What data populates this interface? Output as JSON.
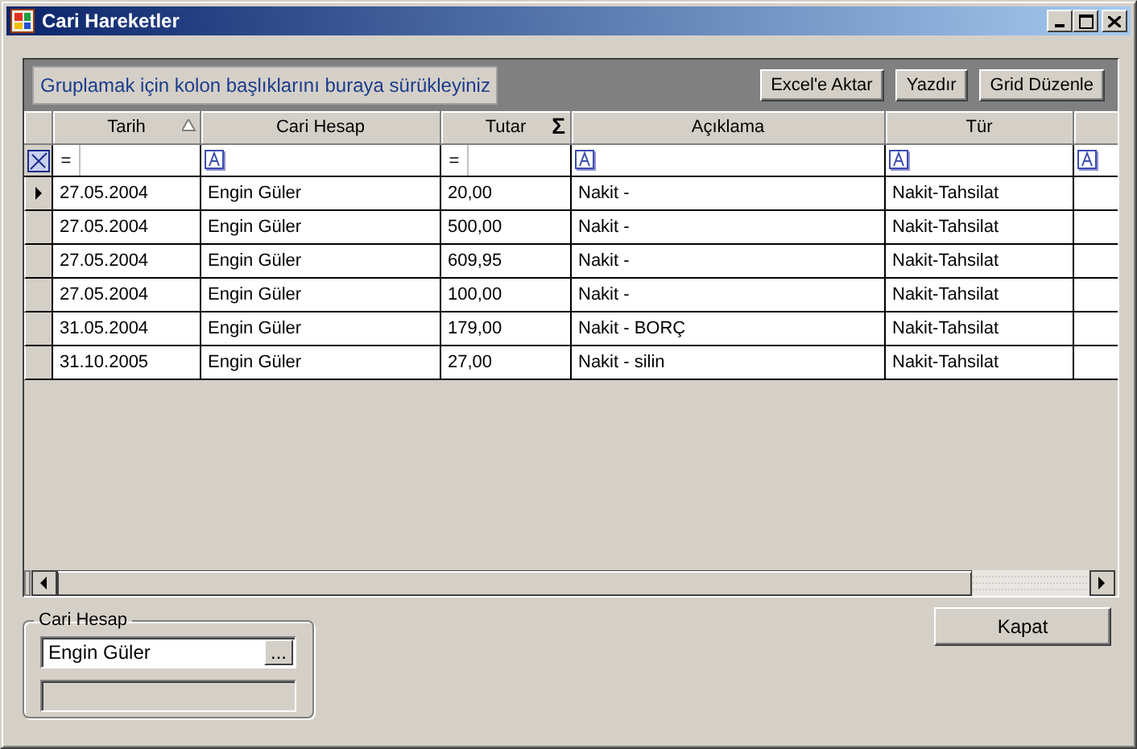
{
  "window": {
    "title": "Cari Hareketler"
  },
  "grid": {
    "group_hint": "Gruplamak için kolon başlıklarını buraya sürükleyiniz",
    "buttons": [
      "Excel'e Aktar",
      "Yazdır",
      "Grid Düzenle"
    ],
    "columns": [
      {
        "label": "Tarih",
        "sorted": true,
        "filter": {
          "kind": "operator",
          "text": "="
        }
      },
      {
        "label": "Cari Hesap",
        "sorted": false,
        "filter": {
          "kind": "text"
        }
      },
      {
        "label": "Tutar",
        "sorted": false,
        "summary": "Σ",
        "filter": {
          "kind": "operator",
          "text": "="
        }
      },
      {
        "label": "Açıklama",
        "sorted": false,
        "filter": {
          "kind": "text"
        }
      },
      {
        "label": "Tür",
        "sorted": false,
        "filter": {
          "kind": "text"
        }
      },
      {
        "sorted": false,
        "filter": {
          "kind": "text"
        }
      }
    ],
    "rows": [
      {
        "selected": true,
        "cells": [
          "27.05.2004",
          "Engin Güler",
          "20,00",
          "Nakit -",
          "Nakit-Tahsilat"
        ]
      },
      {
        "selected": false,
        "cells": [
          "27.05.2004",
          "Engin Güler",
          "500,00",
          "Nakit -",
          "Nakit-Tahsilat"
        ]
      },
      {
        "selected": false,
        "cells": [
          "27.05.2004",
          "Engin Güler",
          "609,95",
          "Nakit -",
          "Nakit-Tahsilat"
        ]
      },
      {
        "selected": false,
        "cells": [
          "27.05.2004",
          "Engin Güler",
          "100,00",
          "Nakit -",
          "Nakit-Tahsilat"
        ]
      },
      {
        "selected": false,
        "cells": [
          "31.05.2004",
          "Engin Güler",
          "179,00",
          "Nakit - BORÇ",
          "Nakit-Tahsilat"
        ]
      },
      {
        "selected": false,
        "cells": [
          "31.10.2005",
          "Engin Güler",
          "27,00",
          "Nakit - silin",
          "Nakit-Tahsilat"
        ]
      }
    ]
  },
  "account_group": {
    "legend": "Cari Hesap",
    "value": "Engin Güler",
    "browse_button": "..."
  },
  "close_button": "Kapat"
}
